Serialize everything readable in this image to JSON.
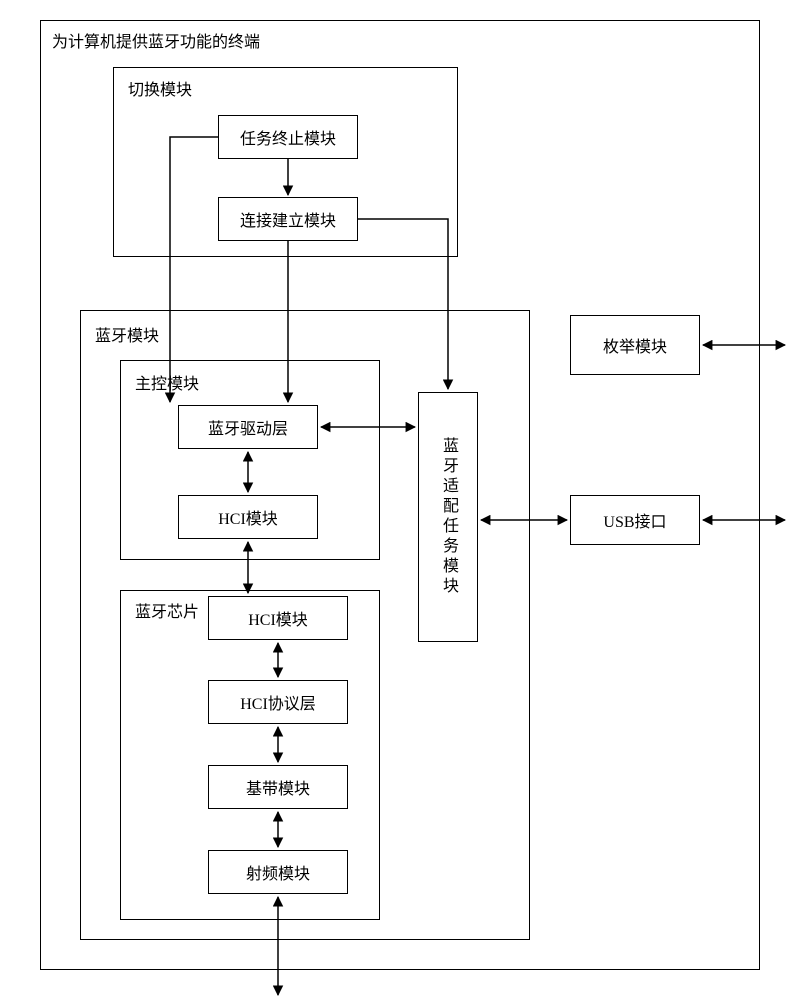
{
  "diagram": {
    "terminal_label": "为计算机提供蓝牙功能的终端",
    "switch_module": {
      "label": "切换模块",
      "task_terminate": "任务终止模块",
      "conn_establish": "连接建立模块"
    },
    "bluetooth_module": {
      "label": "蓝牙模块",
      "host_module": {
        "label": "主控模块",
        "bt_driver": "蓝牙驱动层",
        "hci": "HCI模块"
      },
      "bt_chip": {
        "label": "蓝牙芯片",
        "hci": "HCI模块",
        "hci_proto": "HCI协议层",
        "baseband": "基带模块",
        "rf": "射频模块"
      },
      "adapter_task": "蓝牙适配任务模块"
    },
    "enum_module": "枚举模块",
    "usb_interface": "USB接口"
  }
}
